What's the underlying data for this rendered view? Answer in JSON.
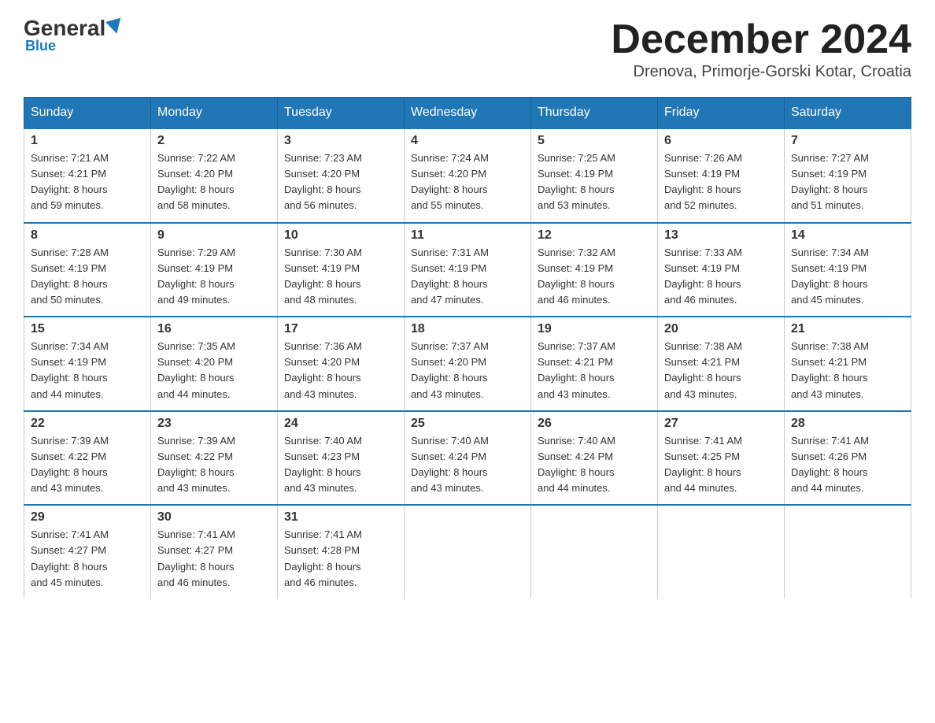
{
  "header": {
    "logo_general": "General",
    "logo_blue": "Blue",
    "month_title": "December 2024",
    "subtitle": "Drenova, Primorje-Gorski Kotar, Croatia"
  },
  "weekdays": [
    "Sunday",
    "Monday",
    "Tuesday",
    "Wednesday",
    "Thursday",
    "Friday",
    "Saturday"
  ],
  "weeks": [
    [
      {
        "day": "1",
        "sunrise": "7:21 AM",
        "sunset": "4:21 PM",
        "daylight": "8 hours and 59 minutes."
      },
      {
        "day": "2",
        "sunrise": "7:22 AM",
        "sunset": "4:20 PM",
        "daylight": "8 hours and 58 minutes."
      },
      {
        "day": "3",
        "sunrise": "7:23 AM",
        "sunset": "4:20 PM",
        "daylight": "8 hours and 56 minutes."
      },
      {
        "day": "4",
        "sunrise": "7:24 AM",
        "sunset": "4:20 PM",
        "daylight": "8 hours and 55 minutes."
      },
      {
        "day": "5",
        "sunrise": "7:25 AM",
        "sunset": "4:19 PM",
        "daylight": "8 hours and 53 minutes."
      },
      {
        "day": "6",
        "sunrise": "7:26 AM",
        "sunset": "4:19 PM",
        "daylight": "8 hours and 52 minutes."
      },
      {
        "day": "7",
        "sunrise": "7:27 AM",
        "sunset": "4:19 PM",
        "daylight": "8 hours and 51 minutes."
      }
    ],
    [
      {
        "day": "8",
        "sunrise": "7:28 AM",
        "sunset": "4:19 PM",
        "daylight": "8 hours and 50 minutes."
      },
      {
        "day": "9",
        "sunrise": "7:29 AM",
        "sunset": "4:19 PM",
        "daylight": "8 hours and 49 minutes."
      },
      {
        "day": "10",
        "sunrise": "7:30 AM",
        "sunset": "4:19 PM",
        "daylight": "8 hours and 48 minutes."
      },
      {
        "day": "11",
        "sunrise": "7:31 AM",
        "sunset": "4:19 PM",
        "daylight": "8 hours and 47 minutes."
      },
      {
        "day": "12",
        "sunrise": "7:32 AM",
        "sunset": "4:19 PM",
        "daylight": "8 hours and 46 minutes."
      },
      {
        "day": "13",
        "sunrise": "7:33 AM",
        "sunset": "4:19 PM",
        "daylight": "8 hours and 46 minutes."
      },
      {
        "day": "14",
        "sunrise": "7:34 AM",
        "sunset": "4:19 PM",
        "daylight": "8 hours and 45 minutes."
      }
    ],
    [
      {
        "day": "15",
        "sunrise": "7:34 AM",
        "sunset": "4:19 PM",
        "daylight": "8 hours and 44 minutes."
      },
      {
        "day": "16",
        "sunrise": "7:35 AM",
        "sunset": "4:20 PM",
        "daylight": "8 hours and 44 minutes."
      },
      {
        "day": "17",
        "sunrise": "7:36 AM",
        "sunset": "4:20 PM",
        "daylight": "8 hours and 43 minutes."
      },
      {
        "day": "18",
        "sunrise": "7:37 AM",
        "sunset": "4:20 PM",
        "daylight": "8 hours and 43 minutes."
      },
      {
        "day": "19",
        "sunrise": "7:37 AM",
        "sunset": "4:21 PM",
        "daylight": "8 hours and 43 minutes."
      },
      {
        "day": "20",
        "sunrise": "7:38 AM",
        "sunset": "4:21 PM",
        "daylight": "8 hours and 43 minutes."
      },
      {
        "day": "21",
        "sunrise": "7:38 AM",
        "sunset": "4:21 PM",
        "daylight": "8 hours and 43 minutes."
      }
    ],
    [
      {
        "day": "22",
        "sunrise": "7:39 AM",
        "sunset": "4:22 PM",
        "daylight": "8 hours and 43 minutes."
      },
      {
        "day": "23",
        "sunrise": "7:39 AM",
        "sunset": "4:22 PM",
        "daylight": "8 hours and 43 minutes."
      },
      {
        "day": "24",
        "sunrise": "7:40 AM",
        "sunset": "4:23 PM",
        "daylight": "8 hours and 43 minutes."
      },
      {
        "day": "25",
        "sunrise": "7:40 AM",
        "sunset": "4:24 PM",
        "daylight": "8 hours and 43 minutes."
      },
      {
        "day": "26",
        "sunrise": "7:40 AM",
        "sunset": "4:24 PM",
        "daylight": "8 hours and 44 minutes."
      },
      {
        "day": "27",
        "sunrise": "7:41 AM",
        "sunset": "4:25 PM",
        "daylight": "8 hours and 44 minutes."
      },
      {
        "day": "28",
        "sunrise": "7:41 AM",
        "sunset": "4:26 PM",
        "daylight": "8 hours and 44 minutes."
      }
    ],
    [
      {
        "day": "29",
        "sunrise": "7:41 AM",
        "sunset": "4:27 PM",
        "daylight": "8 hours and 45 minutes."
      },
      {
        "day": "30",
        "sunrise": "7:41 AM",
        "sunset": "4:27 PM",
        "daylight": "8 hours and 46 minutes."
      },
      {
        "day": "31",
        "sunrise": "7:41 AM",
        "sunset": "4:28 PM",
        "daylight": "8 hours and 46 minutes."
      },
      null,
      null,
      null,
      null
    ]
  ],
  "labels": {
    "sunrise": "Sunrise:",
    "sunset": "Sunset:",
    "daylight": "Daylight:"
  }
}
